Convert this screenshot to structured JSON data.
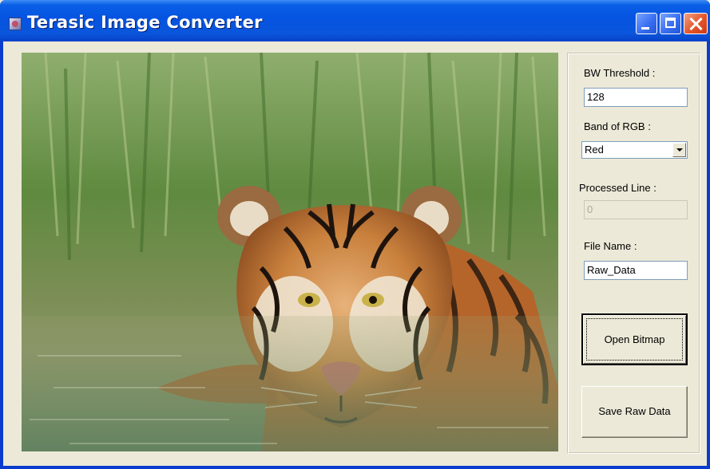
{
  "window": {
    "title": "Terasic Image Converter",
    "title_color": "#ffffff",
    "titlebar_color": "#0553e1"
  },
  "controls": {
    "minimize": "minimize-icon",
    "maximize": "maximize-icon",
    "close": "close-icon"
  },
  "image": {
    "description_icon": "tiger-bitmap-preview"
  },
  "panel": {
    "bw_threshold_label": "BW Threshold :",
    "bw_threshold_value": "128",
    "band_label": "Band of RGB :",
    "band_value": "Red",
    "processed_label": "Processed Line :",
    "processed_value": "0",
    "file_name_label": "File Name :",
    "file_name_value": "Raw_Data",
    "open_button": "Open Bitmap",
    "save_button": "Save Raw Data"
  }
}
